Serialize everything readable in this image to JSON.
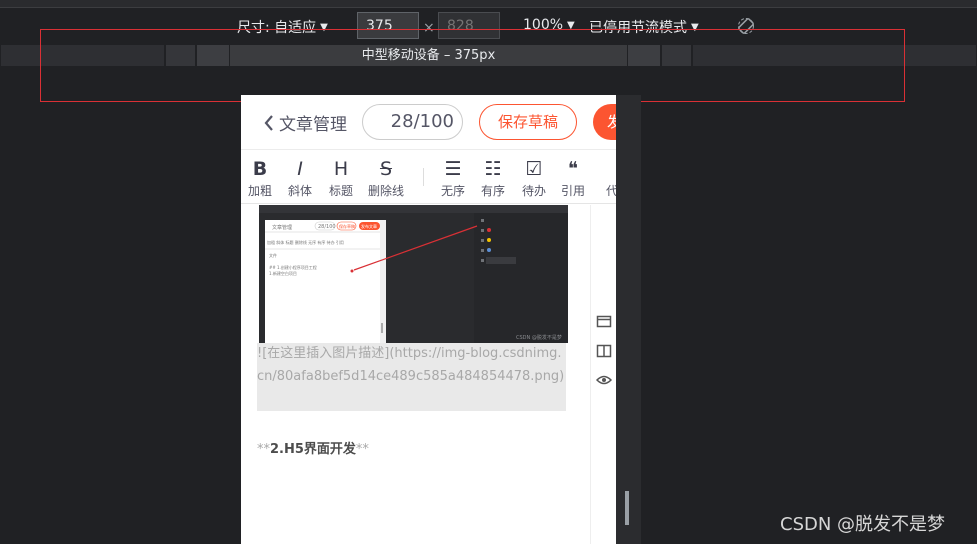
{
  "toolbar": {
    "size_label": "尺寸: 自适应",
    "width_value": "375",
    "height_placeholder": "828",
    "times": "×",
    "zoom": "100%",
    "throttle": "已停用节流模式",
    "caret": "▼"
  },
  "media_query": {
    "label": "中型移动设备 – 375px"
  },
  "app": {
    "back_chevron": "‹",
    "title": "文章管理",
    "counter": "28/100",
    "save_draft": "保存草稿",
    "publish": "发",
    "format_tools": [
      {
        "icon": "B",
        "label": "加粗"
      },
      {
        "icon": "I",
        "label": "斜体"
      },
      {
        "icon": "H",
        "label": "标题"
      },
      {
        "icon": "S",
        "label": "删除线"
      },
      {
        "icon": "☰",
        "label": "无序"
      },
      {
        "icon": "☷",
        "label": "有序"
      },
      {
        "icon": "☑",
        "label": "待办"
      },
      {
        "icon": "❝",
        "label": "引用"
      },
      {
        "icon": "",
        "label": "代"
      }
    ],
    "image_desc": "![在这里插入图片描述](https://img-blog.csdnimg.cn/80afa8bef5d14ce489c585a484854478.png)",
    "h5_prefix": "**",
    "h5_text": "2.H5界面开发",
    "h5_suffix": "**",
    "thumb": {
      "title": "文章管理",
      "counter": "28/100",
      "save": "保存草稿",
      "publish": "发布文章",
      "tools": "加粗 斜体 标题 删除线 无序 有序 待办 引用",
      "line1": "文件",
      "line2": "## 1.创建小程序项目工程",
      "line3": "1.新建空白项目",
      "csdn": "CSDN @脱发不是梦"
    }
  },
  "watermark": "CSDN @脱发不是梦",
  "colors": {
    "accent": "#fc5531",
    "devtools_bg": "#202124",
    "highlight_frame": "#d93035"
  }
}
